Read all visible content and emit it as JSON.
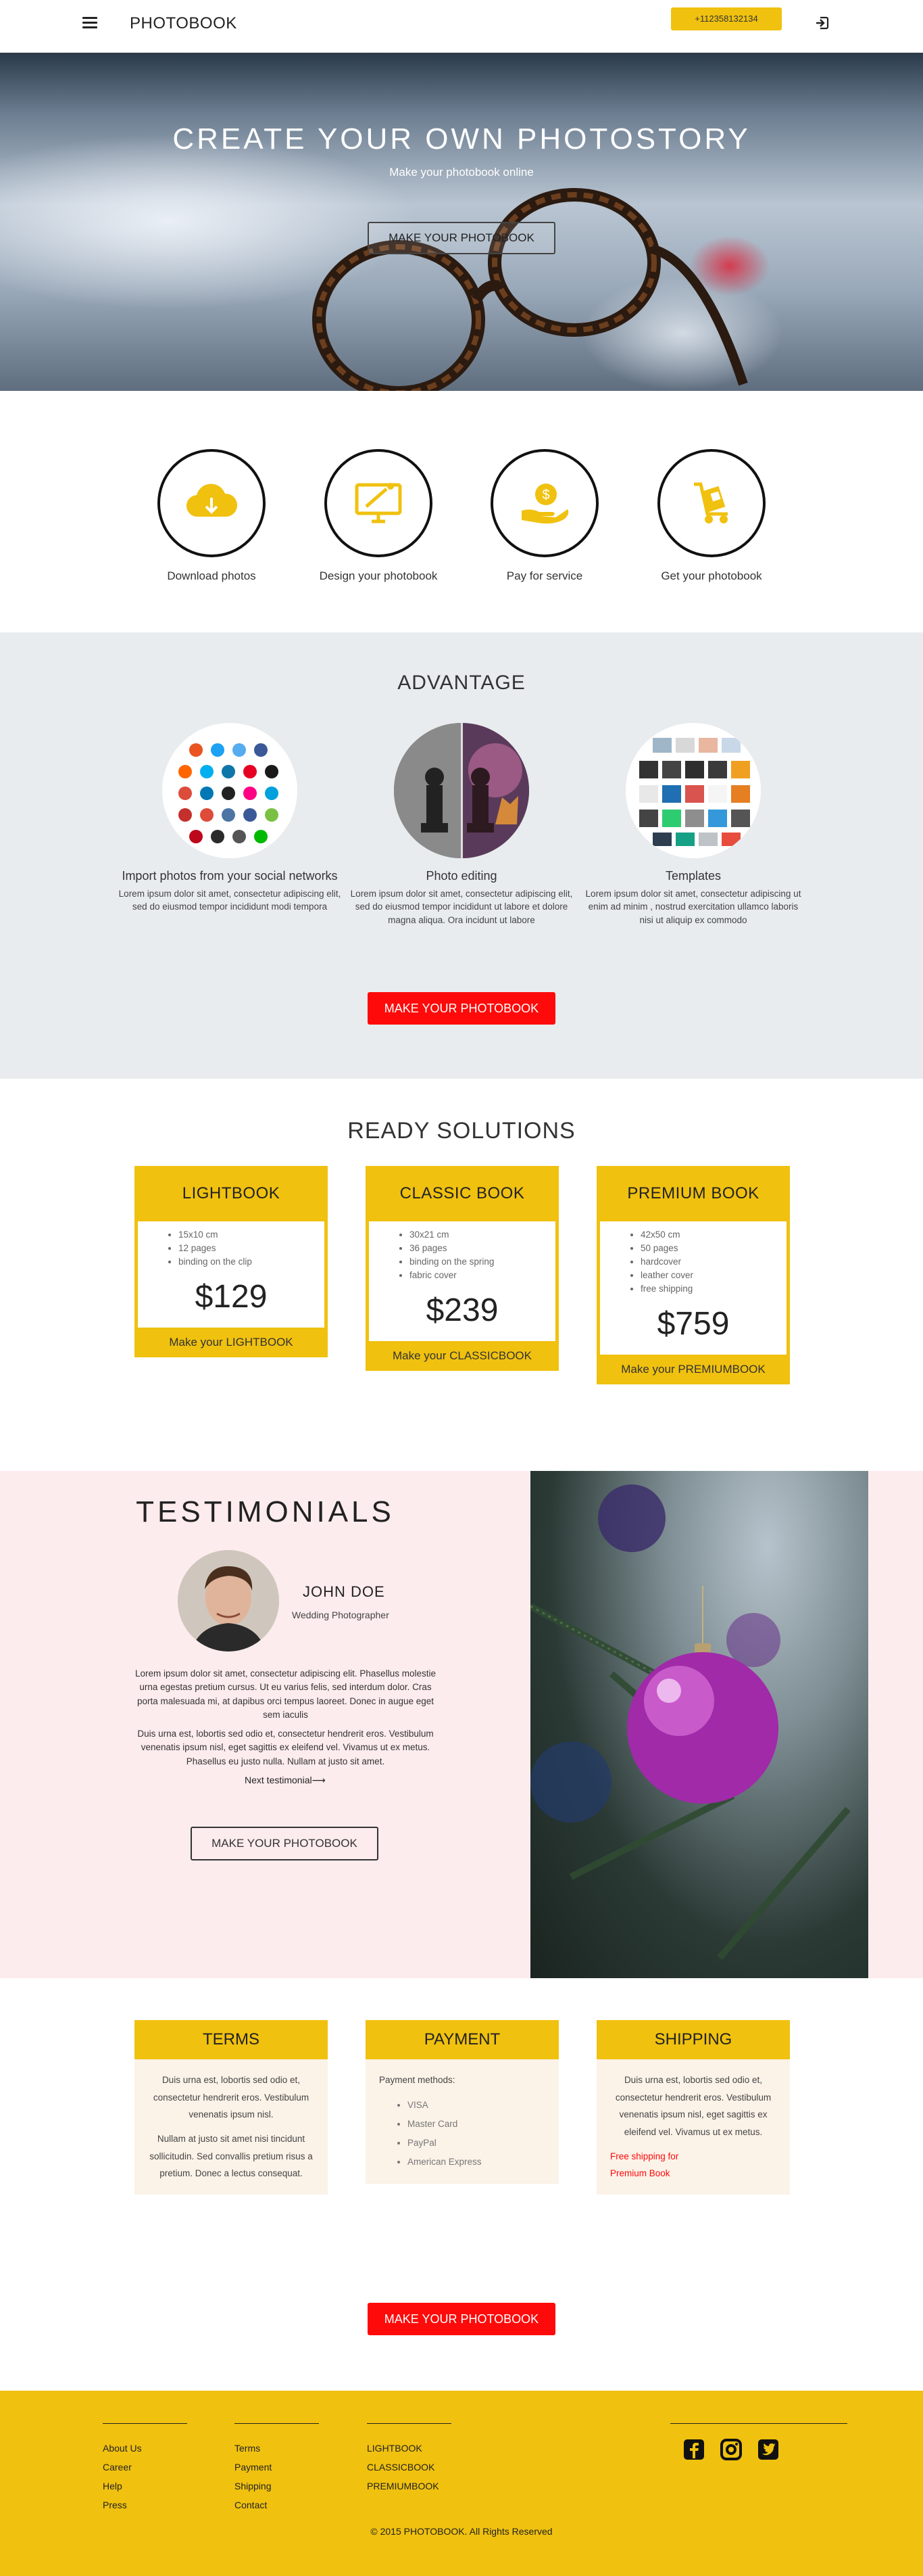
{
  "header": {
    "logo": "PHOTOBOOK",
    "phone": "+112358132134",
    "menu_icon": "hamburger-menu-icon",
    "login_icon": "sign-in-icon"
  },
  "hero": {
    "title": "CREATE YOUR OWN PHOTOSTORY",
    "subtitle": "Make your photobook online",
    "cta": "MAKE YOUR PHOTOBOOK"
  },
  "steps": [
    {
      "label": "Download photos",
      "icon": "cloud-download-icon"
    },
    {
      "label": "Design your photobook",
      "icon": "monitor-design-icon"
    },
    {
      "label": "Pay for service",
      "icon": "hand-coin-icon"
    },
    {
      "label": "Get your photobook",
      "icon": "delivery-trolley-icon"
    }
  ],
  "advantage": {
    "title": "ADVANTAGE",
    "items": [
      {
        "title": "Import photos from your social networks",
        "text": "Lorem ipsum dolor sit amet, consectetur adipiscing elit, sed do eiusmod tempor incididunt modi tempora"
      },
      {
        "title": "Photo editing",
        "text": "Lorem ipsum dolor sit amet, consectetur adipiscing elit, sed do eiusmod tempor incididunt ut labore et dolore magna aliqua. Ora incidunt ut labore"
      },
      {
        "title": "Templates",
        "text": "Lorem ipsum dolor sit amet, consectetur adipiscing ut enim ad minim , nostrud exercitation ullamco laboris nisi ut aliquip ex commodo"
      }
    ],
    "cta": "MAKE YOUR PHOTOBOOK"
  },
  "solutions": {
    "title": "READY SOLUTIONS",
    "cards": [
      {
        "name": "LIGHTBOOK",
        "features": [
          "15x10 cm",
          "12 pages",
          "binding on the clip"
        ],
        "price": "$129",
        "cta": "Make your LIGHTBOOK"
      },
      {
        "name": "CLASSIC BOOK",
        "features": [
          "30x21 cm",
          "36 pages",
          "binding on the spring",
          "fabric cover"
        ],
        "price": "$239",
        "cta": "Make your CLASSICBOOK"
      },
      {
        "name": "PREMIUM BOOK",
        "features": [
          "42x50 cm",
          "50 pages",
          "hardcover",
          "leather cover",
          "free shipping"
        ],
        "price": "$759",
        "cta": "Make your PREMIUMBOOK"
      }
    ]
  },
  "testimonials": {
    "title": "TESTIMONIALS",
    "name": "JOHN DOE",
    "role": "Wedding Photographer",
    "quote_1": "Lorem ipsum dolor sit amet, consectetur adipiscing elit. Phasellus molestie urna egestas pretium cursus. Ut eu varius felis, sed interdum dolor. Cras porta malesuada mi, at dapibus orci tempus laoreet. Donec in augue eget sem iaculis",
    "quote_2": "Duis urna est, lobortis sed odio et, consectetur hendrerit eros. Vestibulum venenatis ipsum nisl, eget sagittis ex eleifend vel. Vivamus ut ex metus. Phasellus eu justo nulla. Nullam at justo sit amet.",
    "next": "Next testimonial⟶",
    "cta": "MAKE YOUR PHOTOBOOK"
  },
  "info": {
    "terms": {
      "title": "TERMS",
      "p1": "Duis urna est, lobortis sed odio et, consectetur hendrerit eros. Vestibulum venenatis ipsum nisl.",
      "p2": "Nullam at justo sit amet nisi tincidunt sollicitudin. Sed convallis pretium risus a pretium. Donec a lectus consequat."
    },
    "payment": {
      "title": "PAYMENT",
      "intro": "Payment methods:",
      "methods": [
        "VISA",
        "Master Card",
        "PayPal",
        "American Express"
      ]
    },
    "shipping": {
      "title": "SHIPPING",
      "p1": "Duis urna est, lobortis sed odio et, consectetur hendrerit eros. Vestibulum venenatis ipsum nisl, eget sagittis ex eleifend vel. Vivamus ut ex metus.",
      "note": "Free shipping for Premium Book"
    },
    "cta": "MAKE YOUR PHOTOBOOK"
  },
  "footer": {
    "col1": [
      "About Us",
      "Career",
      "Help",
      "Press"
    ],
    "col2": [
      "Terms",
      "Payment",
      "Shipping",
      "Contact"
    ],
    "col3": [
      "LIGHTBOOK",
      "CLASSICBOOK",
      "PREMIUMBOOK"
    ],
    "social": [
      "facebook-icon",
      "instagram-icon",
      "twitter-icon"
    ],
    "copyright": "© 2015 PHOTOBOOK. All Rights Reserved"
  },
  "colors": {
    "accent_yellow": "#f0c10f",
    "cta_red": "#ff0a0a",
    "advantage_bg": "#e8ecee",
    "testimonials_bg": "#fdeced"
  }
}
